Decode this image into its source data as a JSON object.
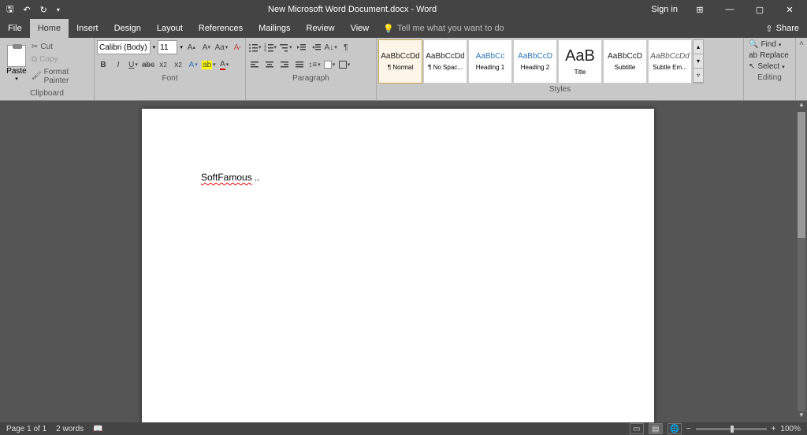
{
  "titlebar": {
    "title": "New Microsoft Word Document.docx  -  Word",
    "signin": "Sign in"
  },
  "tabs": {
    "file": "File",
    "home": "Home",
    "insert": "Insert",
    "design": "Design",
    "layout": "Layout",
    "references": "References",
    "mailings": "Mailings",
    "review": "Review",
    "view": "View",
    "tellme": "Tell me what you want to do",
    "share": "Share"
  },
  "clipboard": {
    "paste": "Paste",
    "cut": "Cut",
    "copy": "Copy",
    "formatpainter": "Format Painter",
    "label": "Clipboard"
  },
  "font": {
    "name": "Calibri (Body)",
    "size": "11",
    "label": "Font"
  },
  "paragraph": {
    "label": "Paragraph"
  },
  "styles": {
    "label": "Styles",
    "items": [
      {
        "preview": "AaBbCcDd",
        "name": "¶ Normal",
        "cls": "",
        "sel": true
      },
      {
        "preview": "AaBbCcDd",
        "name": "¶ No Spac...",
        "cls": ""
      },
      {
        "preview": "AaBbCc",
        "name": "Heading 1",
        "cls": "blue"
      },
      {
        "preview": "AaBbCcD",
        "name": "Heading 2",
        "cls": "blue"
      },
      {
        "preview": "AaB",
        "name": "Title",
        "cls": "big"
      },
      {
        "preview": "AaBbCcD",
        "name": "Subtitle",
        "cls": ""
      },
      {
        "preview": "AaBbCcDd",
        "name": "Subtle Em...",
        "cls": "italic"
      }
    ]
  },
  "editing": {
    "find": "Find",
    "replace": "Replace",
    "select": "Select",
    "label": "Editing"
  },
  "document": {
    "text": "SoftFamous",
    "suffix": " .."
  },
  "status": {
    "page": "Page 1 of 1",
    "words": "2 words",
    "zoom": "100%"
  }
}
